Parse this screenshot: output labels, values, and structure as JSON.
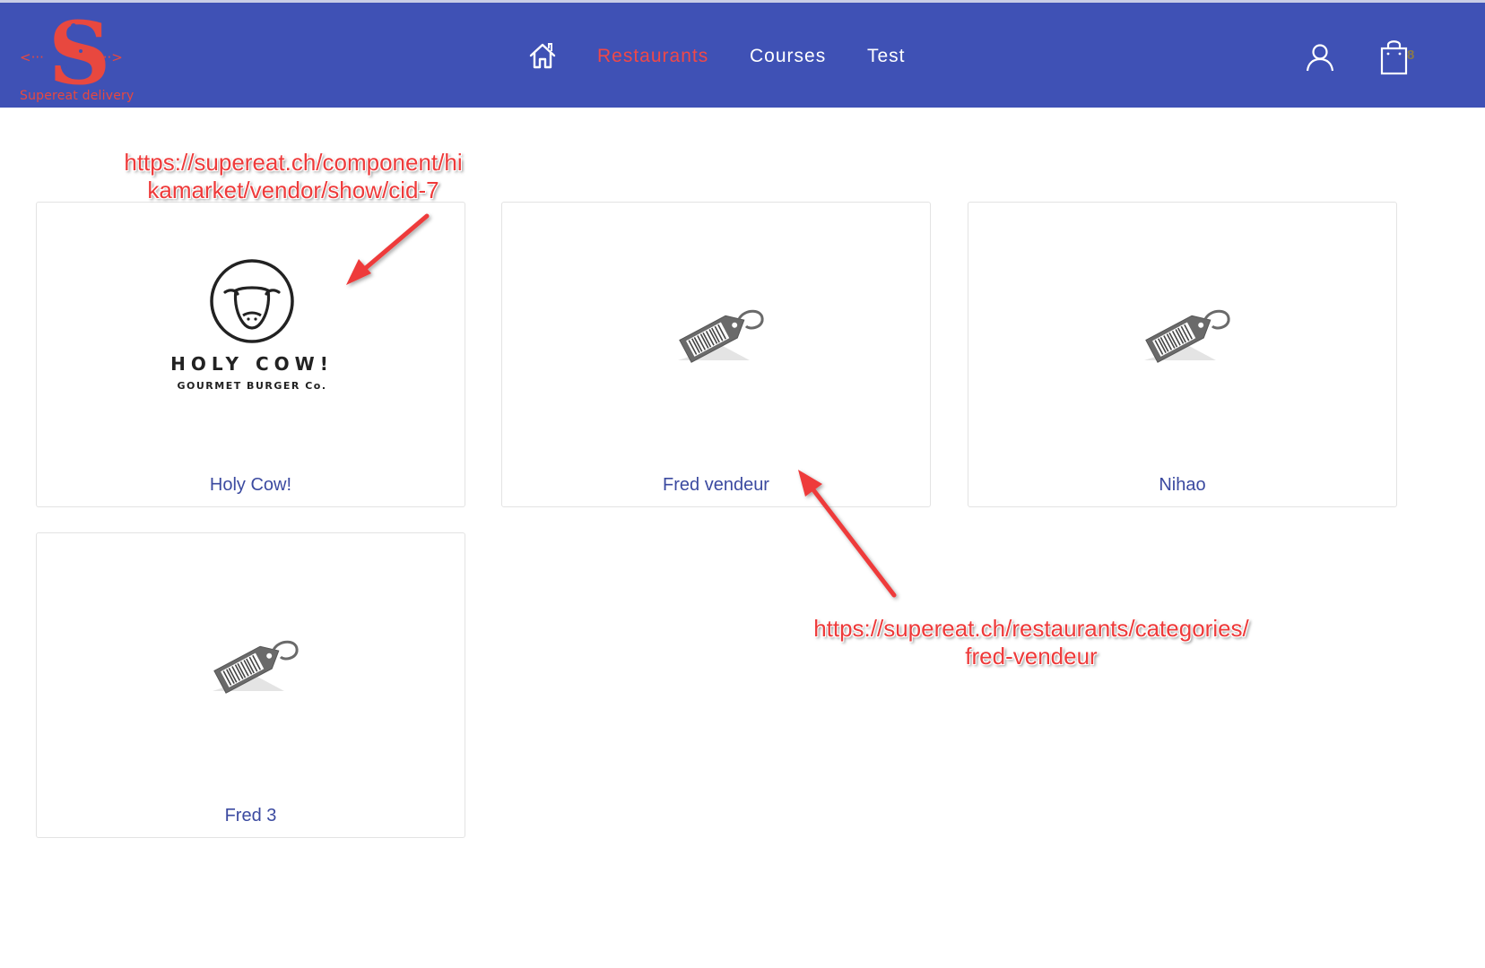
{
  "header": {
    "logo_text": "Supereat delivery",
    "nav": [
      {
        "label": "Restaurants",
        "active": true
      },
      {
        "label": "Courses",
        "active": false
      },
      {
        "label": "Test",
        "active": false
      }
    ],
    "cart_count": "8",
    "icons": {
      "home": "home-icon",
      "user": "user-icon",
      "cart": "shopping-bag-icon"
    },
    "colors": {
      "bar": "#3f51b5",
      "active": "#f04848",
      "logo": "#e8483f"
    }
  },
  "vendors": [
    {
      "name": "Holy Cow!",
      "image": "holy-cow-logo",
      "logo_line1": "HOLY COW!",
      "logo_line2": "GOURMET BURGER Co."
    },
    {
      "name": "Fred vendeur",
      "image": "price-tag-placeholder"
    },
    {
      "name": "Nihao",
      "image": "price-tag-placeholder"
    },
    {
      "name": "Fred 3",
      "image": "price-tag-placeholder"
    }
  ],
  "annotations": [
    {
      "line1": "https://supereat.ch/component/hi",
      "line2": "kamarket/vendor/show/cid-7"
    },
    {
      "line1": "https://supereat.ch/restaurants/categories/",
      "line2": "fred-vendeur"
    }
  ]
}
